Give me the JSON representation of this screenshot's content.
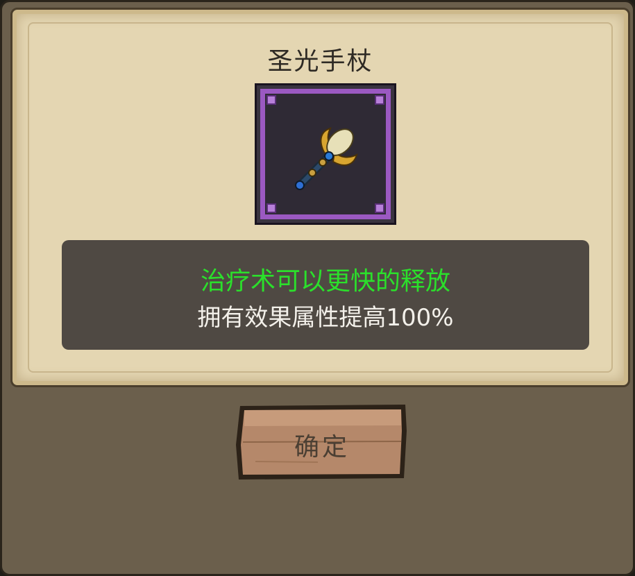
{
  "dialog": {
    "item_name": "圣光手杖",
    "item_icon": "holy-scepter-icon",
    "effect_text": "治疗术可以更快的释放",
    "stat_text": "拥有效果属性提高100%",
    "confirm_label": "确定"
  },
  "colors": {
    "effect_text": "#2be02b",
    "rarity_frame": "#9b59c2"
  }
}
